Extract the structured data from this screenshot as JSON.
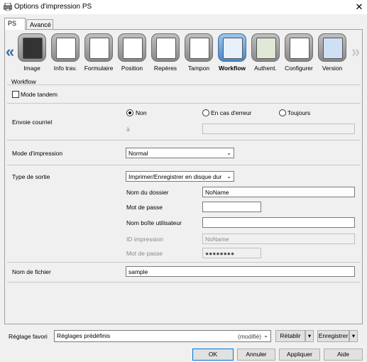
{
  "window": {
    "title": "Options d'impression PS",
    "close_icon": "close-icon"
  },
  "tabs": [
    {
      "label": "PS"
    },
    {
      "label": "Avancé"
    }
  ],
  "toolbar": {
    "items": [
      {
        "label": "Image",
        "icon": "image-icon"
      },
      {
        "label": "Info trav.",
        "icon": "job-info-icon"
      },
      {
        "label": "Formulaire",
        "icon": "form-icon"
      },
      {
        "label": "Position",
        "icon": "position-icon"
      },
      {
        "label": "Repères",
        "icon": "marks-icon"
      },
      {
        "label": "Tampon",
        "icon": "stamp-icon"
      },
      {
        "label": "Workflow",
        "icon": "workflow-icon",
        "selected": true
      },
      {
        "label": "Authent.",
        "icon": "authentication-icon"
      },
      {
        "label": "Configurer",
        "icon": "configure-icon"
      },
      {
        "label": "Version",
        "icon": "version-icon"
      }
    ]
  },
  "workflow": {
    "section_title": "Workflow",
    "mode_tandem": {
      "label": "Mode tandem",
      "checked": false
    },
    "envoie_courriel": {
      "label": "Envoie courriel",
      "options": [
        {
          "label": "Non",
          "selected": true
        },
        {
          "label": "En cas d'erreur",
          "selected": false
        },
        {
          "label": "Toujours",
          "selected": false
        }
      ],
      "to_label": "à",
      "to_value": ""
    },
    "mode_impression": {
      "label": "Mode d'impression",
      "value": "Normal"
    },
    "type_sortie": {
      "label": "Type de sortie",
      "value": "Imprimer/Enregistrer en disque dur",
      "nom_dossier": {
        "label": "Nom du dossier",
        "value": "NoName"
      },
      "mot_de_passe": {
        "label": "Mot de passe",
        "value": ""
      },
      "nom_boite": {
        "label": "Nom boîte utilisateur",
        "value": ""
      },
      "id_impression": {
        "label": "ID impression",
        "value": "NoName"
      },
      "mot_de_passe2": {
        "label": "Mot de passe",
        "value": "●●●●●●●●"
      }
    },
    "nom_fichier": {
      "label": "Nom de fichier",
      "value": "sample"
    }
  },
  "favorites": {
    "label": "Réglage favori",
    "value": "Réglages prédéfinis",
    "modified": "(modifié)",
    "retablir": "Rétablir",
    "enregistrer": "Enregistrer"
  },
  "buttons": {
    "ok": "OK",
    "annuler": "Annuler",
    "appliquer": "Appliquer",
    "aide": "Aide"
  }
}
